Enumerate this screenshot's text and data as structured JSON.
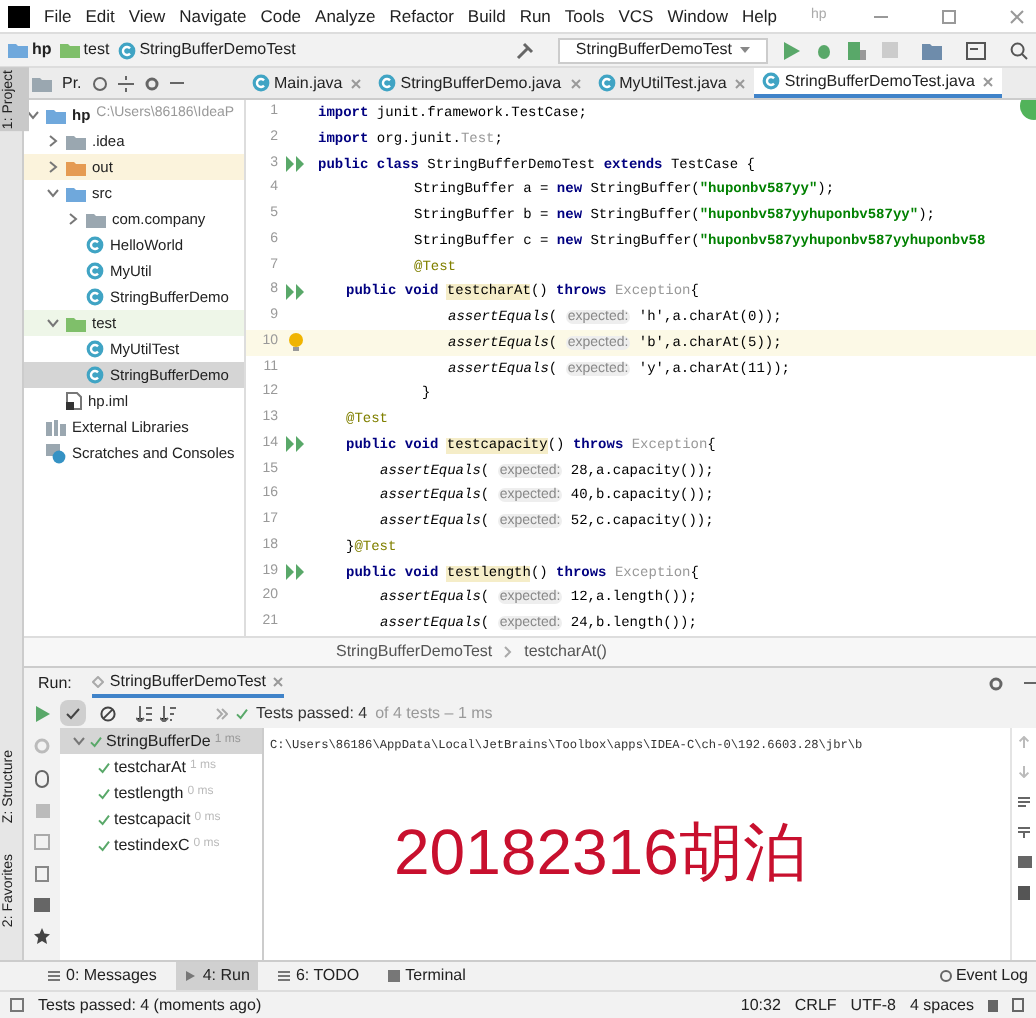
{
  "menu": {
    "items": [
      "File",
      "Edit",
      "View",
      "Navigate",
      "Code",
      "Analyze",
      "Refactor",
      "Build",
      "Run",
      "Tools",
      "VCS",
      "Window",
      "Help"
    ],
    "title": "hp"
  },
  "navbar": {
    "crumbs": [
      {
        "kind": "module",
        "label": "hp"
      },
      {
        "kind": "test-folder",
        "label": "test"
      },
      {
        "kind": "class",
        "label": "StringBufferDemoTest"
      }
    ],
    "run_config": "StringBufferDemoTest"
  },
  "side_labels": [
    {
      "label": "1: Project",
      "selected": true
    },
    {
      "label": "Z: Structure",
      "selected": false
    },
    {
      "label": "2: Favorites",
      "selected": false
    }
  ],
  "project_pane": {
    "title": "Pr.",
    "tree": [
      {
        "kind": "module",
        "label": "hp",
        "path": "C:\\Users\\86186\\IdeaP",
        "expanded": true,
        "selected": false,
        "children": [
          {
            "kind": "folder",
            "label": ".idea",
            "expanded": false,
            "selected": false
          },
          {
            "kind": "excluded-folder",
            "label": "out",
            "expanded": false,
            "selected": false
          },
          {
            "kind": "source-folder",
            "label": "src",
            "expanded": true,
            "selected": false,
            "children": [
              {
                "kind": "package",
                "label": "com.company",
                "expanded": false,
                "selected": false
              },
              {
                "kind": "class",
                "label": "HelloWorld",
                "selected": false
              },
              {
                "kind": "class",
                "label": "MyUtil",
                "selected": false
              },
              {
                "kind": "class",
                "label": "StringBufferDemo",
                "selected": false
              }
            ]
          },
          {
            "kind": "test-folder",
            "label": "test",
            "expanded": true,
            "selected": false,
            "children": [
              {
                "kind": "class",
                "label": "MyUtilTest",
                "selected": false
              },
              {
                "kind": "class",
                "label": "StringBufferDemo",
                "selected": true
              }
            ]
          },
          {
            "kind": "file",
            "label": "hp.iml",
            "selected": false
          }
        ]
      },
      {
        "kind": "libraries",
        "label": "External Libraries",
        "selected": false
      },
      {
        "kind": "scratches",
        "label": "Scratches and Consoles",
        "selected": false
      }
    ]
  },
  "editor_tabs": [
    {
      "label": "Main.java",
      "selected": false
    },
    {
      "label": "StringBufferDemo.java",
      "selected": false
    },
    {
      "label": "MyUtilTest.java",
      "selected": false
    },
    {
      "label": "StringBufferDemoTest.java",
      "selected": true
    }
  ],
  "code": [
    {
      "number": "1",
      "tokens": [
        {
          "kind": "keyword",
          "text": "import"
        },
        {
          "kind": "plain",
          "text": " junit.framework.TestCase;"
        }
      ]
    },
    {
      "number": "2",
      "tokens": [
        {
          "kind": "keyword",
          "text": "import"
        },
        {
          "kind": "plain",
          "text": " org.junit."
        },
        {
          "kind": "unused",
          "text": "Test"
        },
        {
          "kind": "plain",
          "text": ";"
        }
      ]
    },
    {
      "number": "3",
      "gutter": {
        "kind": "run"
      },
      "tokens": [
        {
          "kind": "keyword",
          "text": "public class"
        },
        {
          "kind": "plain",
          "text": " StringBufferDemoTest "
        },
        {
          "kind": "keyword",
          "text": "extends"
        },
        {
          "kind": "plain",
          "text": " TestCase {"
        }
      ]
    },
    {
      "number": "4",
      "indent": {
        "kind": "field"
      },
      "tokens": [
        {
          "kind": "plain",
          "text": "StringBuffer a = "
        },
        {
          "kind": "keyword",
          "text": "new"
        },
        {
          "kind": "plain",
          "text": " StringBuffer("
        },
        {
          "kind": "string",
          "text": "\"huponbv587yy\""
        },
        {
          "kind": "plain",
          "text": ");"
        }
      ]
    },
    {
      "number": "5",
      "indent": {
        "kind": "field"
      },
      "tokens": [
        {
          "kind": "plain",
          "text": "StringBuffer b = "
        },
        {
          "kind": "keyword",
          "text": "new"
        },
        {
          "kind": "plain",
          "text": " StringBuffer("
        },
        {
          "kind": "string",
          "text": "\"huponbv587yyhuponbv587yy\""
        },
        {
          "kind": "plain",
          "text": ");"
        }
      ]
    },
    {
      "number": "6",
      "indent": {
        "kind": "field"
      },
      "tokens": [
        {
          "kind": "plain",
          "text": "StringBuffer c = "
        },
        {
          "kind": "keyword",
          "text": "new"
        },
        {
          "kind": "plain",
          "text": " StringBuffer("
        },
        {
          "kind": "string",
          "text": "\"huponbv587yyhuponbv587yyhuponbv58"
        }
      ]
    },
    {
      "number": "7",
      "indent": {
        "kind": "field"
      },
      "tokens": [
        {
          "kind": "annotation",
          "text": "@Test"
        }
      ]
    },
    {
      "number": "8",
      "indent": {
        "kind": "member"
      },
      "gutter": {
        "kind": "run"
      },
      "tokens": [
        {
          "kind": "keyword",
          "text": "public void "
        },
        {
          "kind": "method",
          "text": "testcharAt"
        },
        {
          "kind": "plain",
          "text": "() "
        },
        {
          "kind": "keyword",
          "text": "throws "
        },
        {
          "kind": "unused",
          "text": "Exception"
        },
        {
          "kind": "plain",
          "text": "{"
        }
      ]
    },
    {
      "number": "9",
      "indent": {
        "kind": "nested"
      },
      "tokens": [
        {
          "kind": "call",
          "text": "assertEquals"
        },
        {
          "kind": "plain",
          "text": "( "
        },
        {
          "kind": "hint",
          "text": "expected:"
        },
        {
          "kind": "plain",
          "text": " 'h',a.charAt(0));"
        }
      ]
    },
    {
      "number": "10",
      "indent": {
        "kind": "nested"
      },
      "current": true,
      "gutter": {
        "kind": "bulb"
      },
      "tokens": [
        {
          "kind": "call",
          "text": "assertEquals"
        },
        {
          "kind": "plain",
          "text": "( "
        },
        {
          "kind": "hint",
          "text": "expected:"
        },
        {
          "kind": "plain",
          "text": " 'b',a.charAt(5));"
        }
      ]
    },
    {
      "number": "11",
      "indent": {
        "kind": "nested"
      },
      "tokens": [
        {
          "kind": "call",
          "text": "assertEquals"
        },
        {
          "kind": "plain",
          "text": "( "
        },
        {
          "kind": "hint",
          "text": "expected:"
        },
        {
          "kind": "plain",
          "text": " 'y',a.charAt(11));"
        }
      ]
    },
    {
      "number": "12",
      "indent": {
        "kind": "closing"
      },
      "tokens": [
        {
          "kind": "plain",
          "text": "}"
        }
      ]
    },
    {
      "number": "13",
      "indent": {
        "kind": "member"
      },
      "tokens": [
        {
          "kind": "annotation",
          "text": "@Test"
        }
      ]
    },
    {
      "number": "14",
      "indent": {
        "kind": "member"
      },
      "gutter": {
        "kind": "run"
      },
      "tokens": [
        {
          "kind": "keyword",
          "text": "public void "
        },
        {
          "kind": "method",
          "text": "testcapacity"
        },
        {
          "kind": "plain",
          "text": "() "
        },
        {
          "kind": "keyword",
          "text": "throws "
        },
        {
          "kind": "unused",
          "text": "Exception"
        },
        {
          "kind": "plain",
          "text": "{"
        }
      ]
    },
    {
      "number": "15",
      "indent": {
        "kind": "statement"
      },
      "tokens": [
        {
          "kind": "call",
          "text": "assertEquals"
        },
        {
          "kind": "plain",
          "text": "( "
        },
        {
          "kind": "hint",
          "text": "expected:"
        },
        {
          "kind": "plain",
          "text": " 28,a.capacity());"
        }
      ]
    },
    {
      "number": "16",
      "indent": {
        "kind": "statement"
      },
      "tokens": [
        {
          "kind": "call",
          "text": "assertEquals"
        },
        {
          "kind": "plain",
          "text": "( "
        },
        {
          "kind": "hint",
          "text": "expected:"
        },
        {
          "kind": "plain",
          "text": " 40,b.capacity());"
        }
      ]
    },
    {
      "number": "17",
      "indent": {
        "kind": "statement"
      },
      "tokens": [
        {
          "kind": "call",
          "text": "assertEquals"
        },
        {
          "kind": "plain",
          "text": "( "
        },
        {
          "kind": "hint",
          "text": "expected:"
        },
        {
          "kind": "plain",
          "text": " 52,c.capacity());"
        }
      ]
    },
    {
      "number": "18",
      "indent": {
        "kind": "member"
      },
      "tokens": [
        {
          "kind": "plain",
          "text": "}"
        },
        {
          "kind": "annotation",
          "text": "@Test"
        }
      ]
    },
    {
      "number": "19",
      "indent": {
        "kind": "member"
      },
      "gutter": {
        "kind": "run"
      },
      "tokens": [
        {
          "kind": "keyword",
          "text": "public void "
        },
        {
          "kind": "method",
          "text": "testlength"
        },
        {
          "kind": "plain",
          "text": "() "
        },
        {
          "kind": "keyword",
          "text": "throws "
        },
        {
          "kind": "unused",
          "text": "Exception"
        },
        {
          "kind": "plain",
          "text": "{"
        }
      ]
    },
    {
      "number": "20",
      "indent": {
        "kind": "statement"
      },
      "tokens": [
        {
          "kind": "call",
          "text": "assertEquals"
        },
        {
          "kind": "plain",
          "text": "( "
        },
        {
          "kind": "hint",
          "text": "expected:"
        },
        {
          "kind": "plain",
          "text": " 12,a.length());"
        }
      ]
    },
    {
      "number": "21",
      "indent": {
        "kind": "statement"
      },
      "tokens": [
        {
          "kind": "call",
          "text": "assertEquals"
        },
        {
          "kind": "plain",
          "text": "( "
        },
        {
          "kind": "hint",
          "text": "expected:"
        },
        {
          "kind": "plain",
          "text": " 24,b.length());"
        }
      ]
    }
  ],
  "breadcrumb": [
    "StringBufferDemoTest",
    "testcharAt()"
  ],
  "run_panel": {
    "label": "Run:",
    "tab": "StringBufferDemoTest",
    "show_passed": true,
    "show_ignored": false,
    "status": "Tests passed: 4",
    "status_detail": "of 4 tests – 1 ms",
    "tests": [
      {
        "label": "StringBufferDe",
        "time": "1 ms",
        "expanded": true,
        "selected": true,
        "children": [
          {
            "label": "testcharAt",
            "time": "1 ms",
            "selected": false
          },
          {
            "label": "testlength",
            "time": "0 ms",
            "selected": false
          },
          {
            "label": "testcapacit",
            "time": "0 ms",
            "selected": false
          },
          {
            "label": "testindexC",
            "time": "0 ms",
            "selected": false
          }
        ]
      }
    ],
    "console": "C:\\Users\\86186\\AppData\\Local\\JetBrains\\Toolbox\\apps\\IDEA-C\\ch-0\\192.6603.28\\jbr\\b"
  },
  "overlay_text": "20182316胡泊",
  "tool_tabs": [
    {
      "kind": "messages",
      "label": "0: Messages",
      "selected": false
    },
    {
      "kind": "run",
      "label": "4: Run",
      "selected": true
    },
    {
      "kind": "todo",
      "label": "6: TODO",
      "selected": false
    },
    {
      "kind": "terminal",
      "label": "Terminal",
      "selected": false
    }
  ],
  "event_log": "Event Log",
  "status_bar": {
    "message": "Tests passed: 4 (moments ago)",
    "items": [
      "10:32",
      "CRLF",
      "UTF-8",
      "4 spaces"
    ]
  }
}
